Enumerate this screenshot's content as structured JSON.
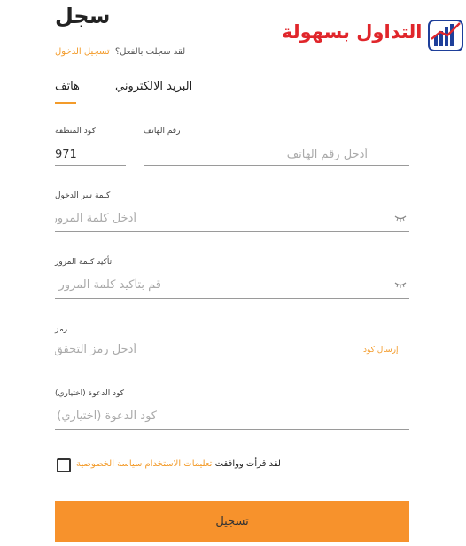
{
  "header": {
    "title": "سجل",
    "login_prompt": "لقد سجلت بالفعل؟",
    "login_link": "تسجيل الدخول"
  },
  "logo": {
    "text": "التداول بسهولة",
    "mark_icon": "bar-chart-logo-icon",
    "text_color": "#e0262b",
    "mark_color": "#1e3f9a"
  },
  "tabs": [
    {
      "label": "هاتف",
      "active": true
    },
    {
      "label": "البريد الالكتروني",
      "active": false
    }
  ],
  "form": {
    "area_code": {
      "label": "كود المنطقة",
      "value": "971"
    },
    "phone": {
      "label": "رقم الهاتف",
      "placeholder": "أدخل رقم الهاتف"
    },
    "password": {
      "label": "كلمة سر الدخول",
      "placeholder": "أدخل كلمة المرور",
      "icon": "eye-closed-icon"
    },
    "confirm_password": {
      "label": "تأكيد كلمة المرور",
      "placeholder": "قم بتأكيد كلمة المرور",
      "icon": "eye-closed-icon"
    },
    "code": {
      "label": "رمز",
      "placeholder": "أدخل رمز التحقق",
      "send_label": "إرسال كود"
    },
    "invite": {
      "label": "كود الدعوة (اختياري)",
      "placeholder": "كود الدعوة (اختياري)"
    }
  },
  "terms": {
    "prefix": "لقد قرأت ووافقت",
    "link1": "تعليمات الاستخدام",
    "link2": "سياسة الخصوصية",
    "checked": false
  },
  "submit_label": "تسجيل",
  "colors": {
    "accent": "#f39b2a",
    "button": "#f7922c"
  }
}
